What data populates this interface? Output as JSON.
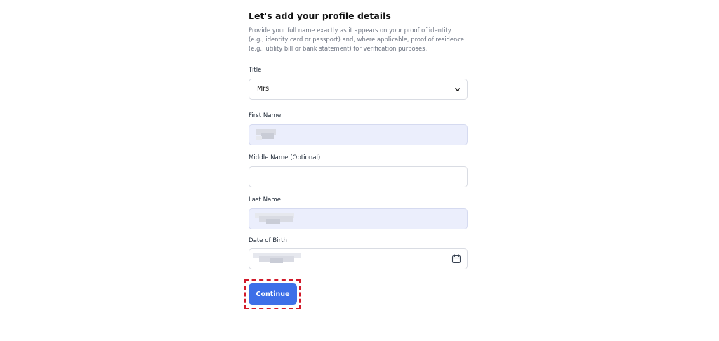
{
  "form": {
    "title": "Let's add your profile details",
    "description": "Provide your full name exactly as it appears on your proof of identity (e.g., identity card or passport) and, where applicable, proof of residence (e.g., utility bill or bank statement) for verification purposes."
  },
  "fields": {
    "title": {
      "label": "Title",
      "value": "Mrs",
      "icon": "chevron-down-icon"
    },
    "first_name": {
      "label": "First Name"
    },
    "middle_name": {
      "label": "Middle Name (Optional)",
      "value": ""
    },
    "last_name": {
      "label": "Last Name"
    },
    "date_of_birth": {
      "label": "Date of Birth",
      "icon": "calendar-icon"
    }
  },
  "actions": {
    "continue_label": "Continue"
  },
  "colors": {
    "primary": "#3d6fe8",
    "autofill_bg": "#ebeefc",
    "highlight_outline": "#d11a2a",
    "muted_text": "#6b7280"
  }
}
